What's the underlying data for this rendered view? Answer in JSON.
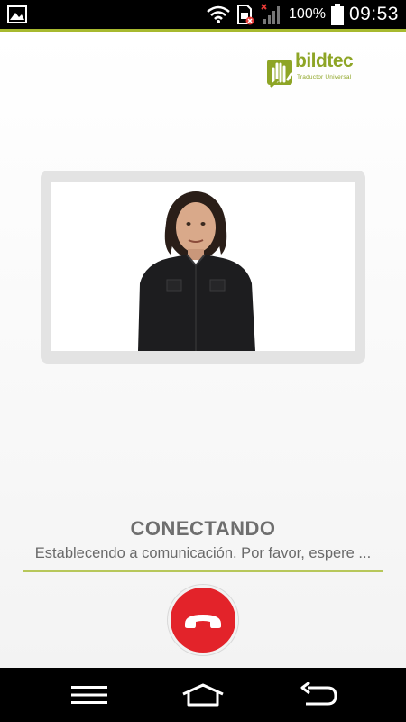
{
  "status_bar": {
    "battery_percent": "100%",
    "time": "09:53",
    "icons": [
      "gallery-icon",
      "wifi-icon",
      "sim-disabled-icon",
      "signal-no-service-icon",
      "battery-icon"
    ]
  },
  "brand": {
    "name": "bildtec",
    "tagline": "Traductor Universal",
    "color": "#8ea526"
  },
  "call": {
    "status_title": "CONECTANDO",
    "status_message": "Establecendo a comunicación. Por favor, espere ...",
    "hangup_color": "#e3232a",
    "hangup_icon": "phone-hangup-icon"
  },
  "nav_bar": {
    "icons": [
      "menu-icon",
      "home-icon",
      "back-icon"
    ]
  },
  "colors": {
    "accent": "#a7b92f"
  }
}
